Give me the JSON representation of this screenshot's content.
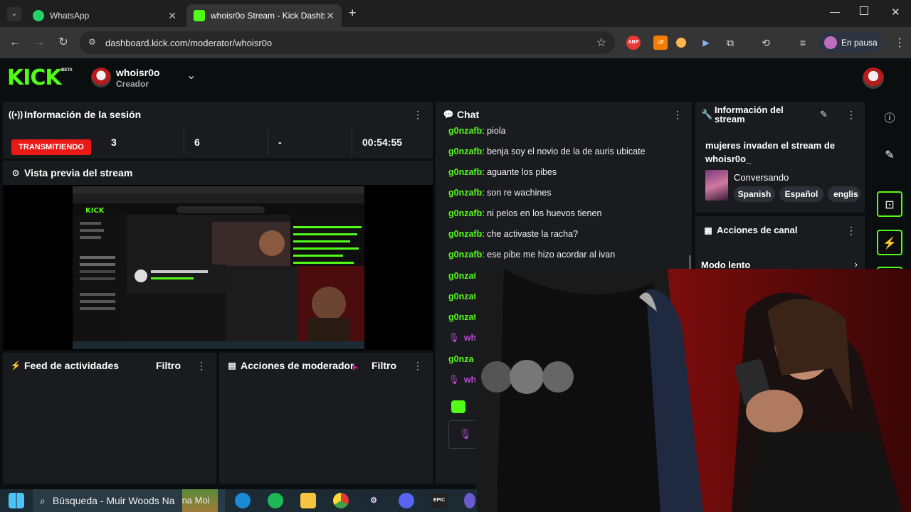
{
  "browser": {
    "tabs": [
      {
        "title": "WhatsApp"
      },
      {
        "title": "whoisr0o Stream - Kick Dashbo"
      }
    ],
    "url": "dashboard.kick.com/moderator/whoisr0o",
    "profile_label": "En pausa",
    "ext_badge": "off"
  },
  "header": {
    "logo": "KICK",
    "logo_badge": "BETA",
    "channel_name": "whoisr0o",
    "channel_role": "Creador"
  },
  "session": {
    "title": "Información de la sesión",
    "status": "TRANSMITIENDO",
    "stats": [
      "3",
      "6",
      "-",
      "00:54:55"
    ]
  },
  "preview": {
    "title": "Vista previa del stream"
  },
  "feed": {
    "title": "Feed de actividades",
    "filter": "Filtro"
  },
  "moderator": {
    "title": "Acciones de moderador",
    "filter": "Filtro"
  },
  "chat": {
    "title": "Chat",
    "messages": [
      {
        "user": "g0nzafb",
        "text": ": piola"
      },
      {
        "user": "g0nzafb",
        "text": ": benja soy el novio de la de auris ubicate"
      },
      {
        "user": "g0nzafb",
        "text": ": aguante los pibes"
      },
      {
        "user": "g0nzafb",
        "text": ": son re wachines"
      },
      {
        "user": "g0nzafb",
        "text": ": ni pelos en los huevos tienen"
      },
      {
        "user": "g0nzafb",
        "text": ": che activaste la racha?"
      },
      {
        "user": "g0nzafb",
        "text": ": ese pibe me hizo acordar al ivan"
      },
      {
        "user": "g0nzat",
        "text": ""
      },
      {
        "user": "g0nzat",
        "text": ""
      },
      {
        "user": "g0nzat",
        "text": ""
      },
      {
        "user": "wh",
        "text": ""
      },
      {
        "user": "g0nza",
        "text": ""
      },
      {
        "user": "wh",
        "text": ""
      }
    ]
  },
  "stream_info": {
    "title": "Información del stream",
    "stream_title": "mujeres invaden el stream de whoisr0o_",
    "category": "Conversando",
    "tags": [
      "Spanish",
      "Español",
      "englis"
    ]
  },
  "channel_actions": {
    "title": "Acciones de canal",
    "item": "Modo lento"
  },
  "taskbar": {
    "search_text": "Búsqueda - Muir Woods Na",
    "search_text_tail": "na Moi"
  },
  "colors": {
    "kick_green": "#53fc18",
    "live_red": "#e91916",
    "panel_bg": "#191b1f"
  }
}
